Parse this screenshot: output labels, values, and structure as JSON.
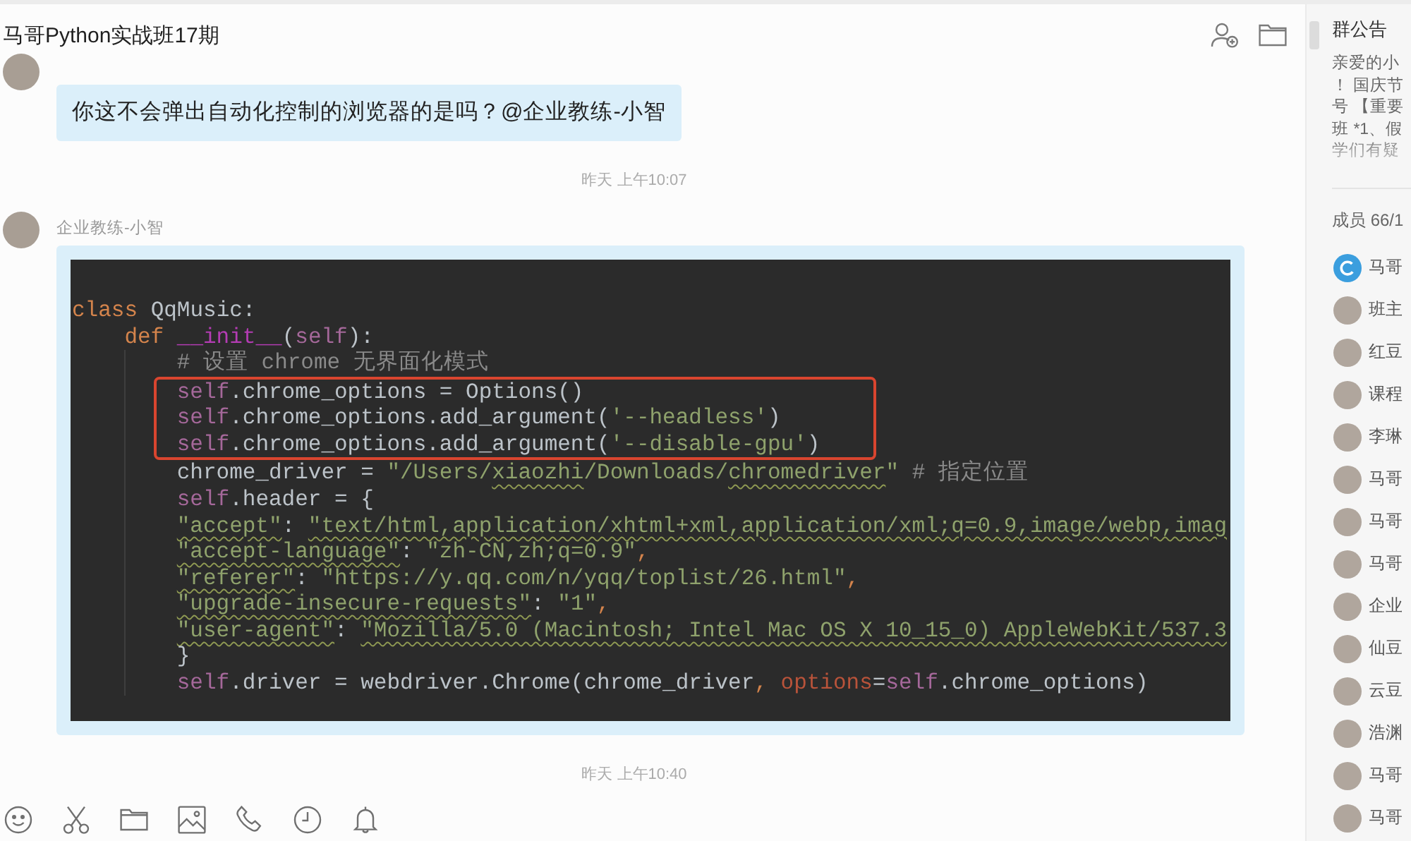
{
  "header": {
    "title": "马哥Python实战班17期"
  },
  "messages": [
    {
      "kind": "text",
      "text": "你这不会弹出自动化控制的浏览器的是吗？@企业教练-小智"
    },
    {
      "kind": "timestamp",
      "text": "昨天 上午10:07"
    },
    {
      "kind": "code",
      "sender": "企业教练-小智",
      "lines": [
        {
          "highlighted": false,
          "tokens": [
            {
              "kind": "keyword",
              "text": "class"
            },
            {
              "kind": "plain",
              "text": " QqMusic:"
            }
          ],
          "children": [
            {
              "highlighted": false,
              "tokens": [
                {
                  "kind": "keyword",
                  "text": "def "
                },
                {
                  "kind": "magic",
                  "text": "__init__"
                },
                {
                  "kind": "plain",
                  "text": "("
                },
                {
                  "kind": "self",
                  "text": "self"
                },
                {
                  "kind": "plain",
                  "text": "):"
                }
              ],
              "children": [
                {
                  "highlighted": false,
                  "tokens": [
                    {
                      "kind": "comment",
                      "text": "# 设置 chrome 无界面化模式"
                    }
                  ]
                },
                {
                  "highlighted": true,
                  "tokens": [
                    {
                      "kind": "self",
                      "text": "self"
                    },
                    {
                      "kind": "plain",
                      "text": ".chrome_options = Options()"
                    }
                  ]
                },
                {
                  "highlighted": true,
                  "tokens": [
                    {
                      "kind": "self",
                      "text": "self"
                    },
                    {
                      "kind": "plain",
                      "text": ".chrome_options.add_argument("
                    },
                    {
                      "kind": "string",
                      "text": "'--headless'"
                    },
                    {
                      "kind": "plain",
                      "text": ")"
                    }
                  ]
                },
                {
                  "highlighted": true,
                  "tokens": [
                    {
                      "kind": "self",
                      "text": "self"
                    },
                    {
                      "kind": "plain",
                      "text": ".chrome_options.add_argument("
                    },
                    {
                      "kind": "string",
                      "text": "'--disable-gpu'"
                    },
                    {
                      "kind": "plain",
                      "text": ")"
                    }
                  ]
                },
                {
                  "highlighted": false,
                  "tokens": [
                    {
                      "kind": "plain",
                      "text": "chrome_driver = "
                    },
                    {
                      "kind": "string",
                      "text": "\"/Users/"
                    },
                    {
                      "kind": "typo",
                      "text": "xiaozhi"
                    },
                    {
                      "kind": "string",
                      "text": "/Downloads/"
                    },
                    {
                      "kind": "typo",
                      "text": "chromedriver"
                    },
                    {
                      "kind": "string",
                      "text": "\""
                    },
                    {
                      "kind": "comment",
                      "text": " # 指定位置"
                    }
                  ]
                },
                {
                  "highlighted": false,
                  "tokens": [
                    {
                      "kind": "self",
                      "text": "self"
                    },
                    {
                      "kind": "plain",
                      "text": ".header = {"
                    }
                  ]
                },
                {
                  "highlighted": false,
                  "tokens": [
                    {
                      "kind": "typo",
                      "text": "\"accept\""
                    },
                    {
                      "kind": "plain",
                      "text": ": "
                    },
                    {
                      "kind": "typo",
                      "text": "\"text/html,application/xhtml+xml,application/xml;q=0.9,image/webp,imag"
                    }
                  ]
                },
                {
                  "highlighted": false,
                  "tokens": [
                    {
                      "kind": "typo",
                      "text": "\"accept-language\""
                    },
                    {
                      "kind": "plain",
                      "text": ": "
                    },
                    {
                      "kind": "string",
                      "text": "\"zh-CN,zh;q=0.9\""
                    },
                    {
                      "kind": "keyword",
                      "text": ","
                    }
                  ]
                },
                {
                  "highlighted": false,
                  "tokens": [
                    {
                      "kind": "typo",
                      "text": "\"referer\""
                    },
                    {
                      "kind": "plain",
                      "text": ": "
                    },
                    {
                      "kind": "string",
                      "text": "\"https://y.qq.com/n/yqq/toplist/26.html\""
                    },
                    {
                      "kind": "keyword",
                      "text": ","
                    }
                  ]
                },
                {
                  "highlighted": false,
                  "tokens": [
                    {
                      "kind": "typo",
                      "text": "\"upgrade-insecure-requests\""
                    },
                    {
                      "kind": "plain",
                      "text": ": "
                    },
                    {
                      "kind": "string",
                      "text": "\"1\""
                    },
                    {
                      "kind": "keyword",
                      "text": ","
                    }
                  ]
                },
                {
                  "highlighted": false,
                  "tokens": [
                    {
                      "kind": "typo",
                      "text": "\"user-agent\""
                    },
                    {
                      "kind": "plain",
                      "text": ": "
                    },
                    {
                      "kind": "typo",
                      "text": "\"Mozilla/5.0 (Macintosh; Intel Mac OS X 10_15_0) AppleWebKit/537.3"
                    }
                  ]
                },
                {
                  "highlighted": false,
                  "tokens": [
                    {
                      "kind": "plain",
                      "text": "}"
                    }
                  ]
                },
                {
                  "highlighted": false,
                  "tokens": [
                    {
                      "kind": "self",
                      "text": "self"
                    },
                    {
                      "kind": "plain",
                      "text": ".driver = webdriver.Chrome(chrome_driver"
                    },
                    {
                      "kind": "keyword",
                      "text": ", "
                    },
                    {
                      "kind": "param",
                      "text": "options"
                    },
                    {
                      "kind": "plain",
                      "text": "="
                    },
                    {
                      "kind": "self",
                      "text": "self"
                    },
                    {
                      "kind": "plain",
                      "text": ".chrome_options)"
                    }
                  ]
                }
              ]
            }
          ]
        }
      ]
    },
    {
      "kind": "timestamp",
      "text": "昨天 上午10:40"
    }
  ],
  "sidebar": {
    "announcement": {
      "title": "群公告",
      "lines": [
        "亲爱的小",
        "！ 国庆节",
        "号 【重要",
        "班 *1、假",
        "学们有疑"
      ]
    },
    "members_label": "成员 66/1",
    "members": [
      {
        "kind": "logo",
        "name": "马哥"
      },
      {
        "kind": "photo",
        "name": "班主"
      },
      {
        "kind": "photo",
        "name": "红豆"
      },
      {
        "kind": "photo",
        "name": "课程"
      },
      {
        "kind": "photo",
        "name": "李琳"
      },
      {
        "kind": "photo",
        "name": "马哥"
      },
      {
        "kind": "photo",
        "name": "马哥"
      },
      {
        "kind": "photo",
        "name": "马哥"
      },
      {
        "kind": "photo",
        "name": "企业"
      },
      {
        "kind": "photo",
        "name": "仙豆"
      },
      {
        "kind": "photo",
        "name": "云豆"
      },
      {
        "kind": "photo",
        "name": "浩渊"
      },
      {
        "kind": "photo",
        "name": "马哥"
      },
      {
        "kind": "photo",
        "name": "马哥"
      }
    ]
  }
}
